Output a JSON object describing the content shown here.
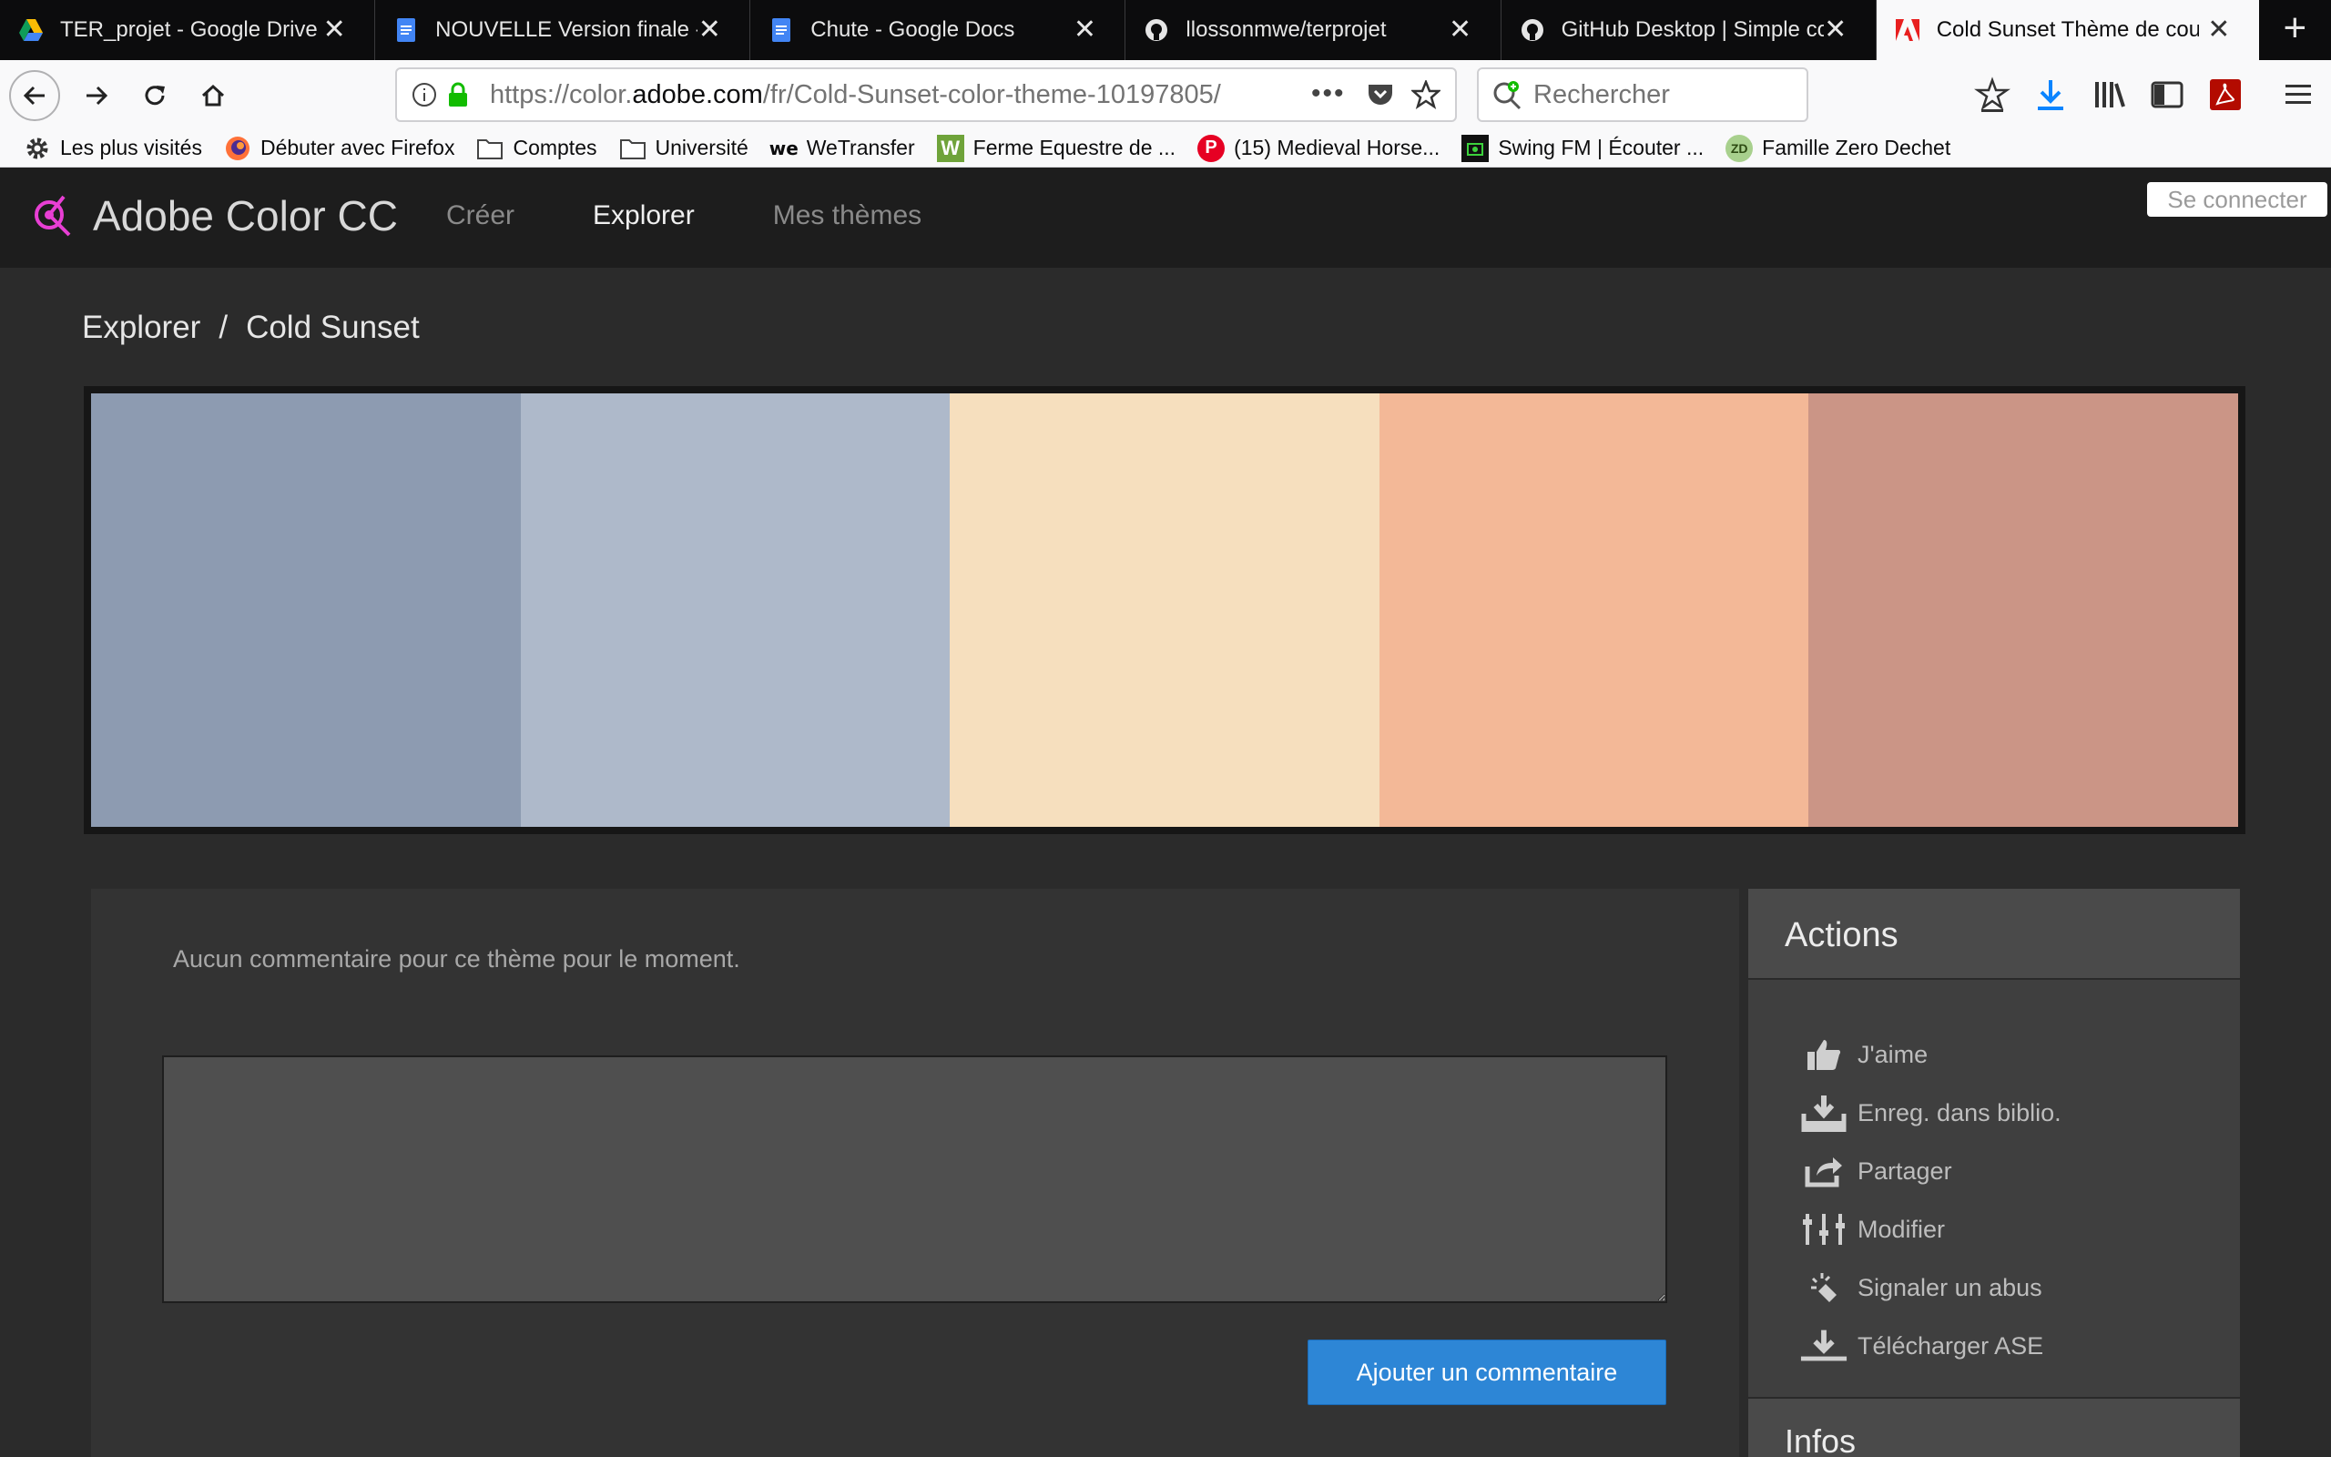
{
  "browser": {
    "tabs": [
      {
        "title": "TER_projet - Google Drive",
        "icon": "google-drive-icon"
      },
      {
        "title": "NOUVELLE Version finale - G",
        "icon": "google-docs-icon"
      },
      {
        "title": "Chute - Google Docs",
        "icon": "google-docs-icon"
      },
      {
        "title": "llossonmwe/terprojet",
        "icon": "github-icon"
      },
      {
        "title": "GitHub Desktop | Simple col",
        "icon": "github-icon"
      },
      {
        "title": "Cold Sunset Thème de coule",
        "icon": "adobe-icon",
        "active": true
      }
    ],
    "url_prefix": "https://color.",
    "url_domain": "adobe.com",
    "url_path": "/fr/Cold-Sunset-color-theme-10197805/",
    "search_placeholder": "Rechercher",
    "bookmarks": [
      {
        "label": "Les plus visités",
        "icon": "gear-icon"
      },
      {
        "label": "Débuter avec Firefox",
        "icon": "firefox-icon"
      },
      {
        "label": "Comptes",
        "icon": "folder-icon"
      },
      {
        "label": "Université",
        "icon": "folder-icon"
      },
      {
        "label": "WeTransfer",
        "icon": "wetransfer-icon"
      },
      {
        "label": "Ferme Equestre de ...",
        "icon": "w-icon"
      },
      {
        "label": "(15) Medieval Horse...",
        "icon": "pinterest-icon"
      },
      {
        "label": "Swing FM | Écouter ...",
        "icon": "radio-icon"
      },
      {
        "label": "Famille Zero Dechet",
        "icon": "zd-icon"
      }
    ]
  },
  "site": {
    "brand": "Adobe Color CC",
    "nav": [
      {
        "label": "Créer",
        "active": false
      },
      {
        "label": "Explorer",
        "active": true
      },
      {
        "label": "Mes thèmes",
        "active": false
      }
    ],
    "signin": "Se connecter"
  },
  "breadcrumb": {
    "root": "Explorer",
    "separator": "/",
    "current": "Cold Sunset"
  },
  "theme": {
    "colors": [
      "#8d9bb1",
      "#aeb9ca",
      "#f6dfbe",
      "#f3b897",
      "#cb9586"
    ]
  },
  "comments": {
    "empty_text": "Aucun commentaire pour ce thème pour le moment.",
    "textarea_value": "",
    "add_button": "Ajouter un commentaire"
  },
  "actions": {
    "title": "Actions",
    "items": [
      {
        "label": "J'aime",
        "icon": "thumbs-up-icon"
      },
      {
        "label": "Enreg. dans biblio.",
        "icon": "save-library-icon"
      },
      {
        "label": "Partager",
        "icon": "share-icon"
      },
      {
        "label": "Modifier",
        "icon": "sliders-icon"
      },
      {
        "label": "Signaler un abus",
        "icon": "report-icon"
      },
      {
        "label": "Télécharger ASE",
        "icon": "download-icon"
      }
    ],
    "infos_title": "Infos"
  }
}
